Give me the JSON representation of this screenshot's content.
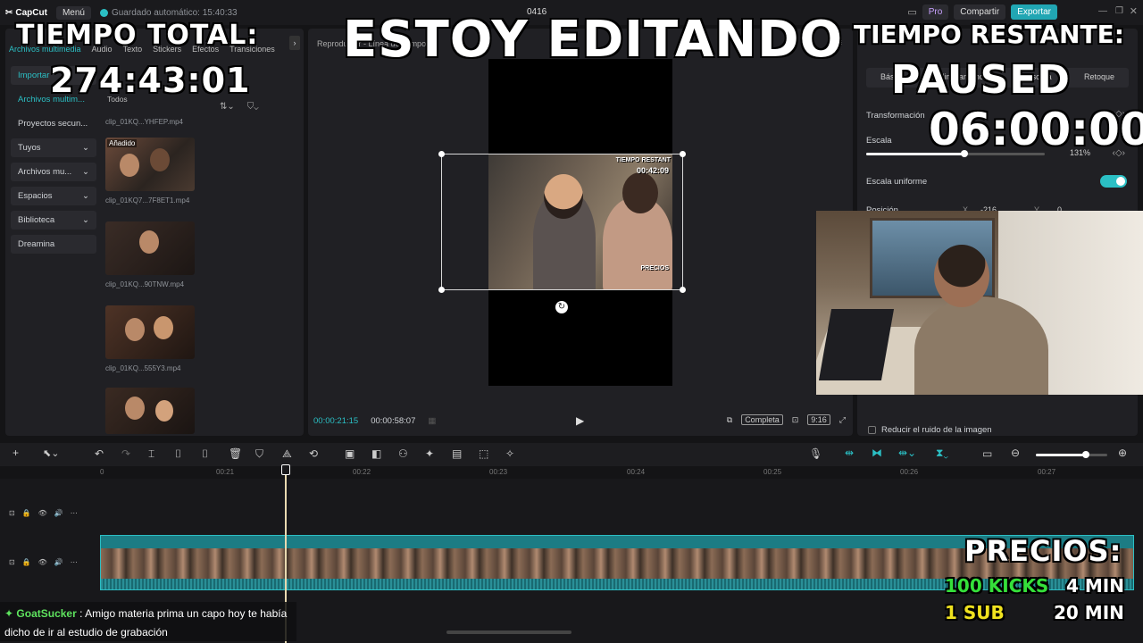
{
  "topbar": {
    "logo": "CapCut",
    "menu": "Menú",
    "autosave": "Guardado automático: 15:40:33",
    "project_name": "0416",
    "pro": "Pro",
    "share": "Compartir",
    "export": "Exportar"
  },
  "left_panel": {
    "tabs": [
      "Archivos multimedia",
      "Audio",
      "Texto",
      "Stickers",
      "Efectos",
      "Transiciones"
    ],
    "nav": [
      {
        "label": "Importar",
        "active": true
      },
      {
        "label": "Archivos multim...",
        "active": false
      },
      {
        "label": "Proyectos secun...",
        "active": false
      },
      {
        "label": "Tuyos",
        "arrow": "⌄"
      },
      {
        "label": "Archivos mu...",
        "arrow": "⌄"
      },
      {
        "label": "Espacios",
        "arrow": "⌄"
      },
      {
        "label": "Biblioteca",
        "arrow": "⌄"
      },
      {
        "label": "Dreamina",
        "arrow": ""
      }
    ],
    "filter_all": "Todos",
    "added_badge": "Añadido",
    "media": [
      {
        "name": "clip_01KQ...YHFEP.mp4"
      },
      {
        "name": "clip_01KQ7...7F8ET1.mp4"
      },
      {
        "name": "clip_01KQ...90TNW.mp4"
      },
      {
        "name": "clip_01KQ...555Y3.mp4"
      }
    ]
  },
  "preview": {
    "title": "Reproductor - Línea de tiempo",
    "current_time": "00:00:21:15",
    "total_time": "00:00:58:07",
    "full_label": "Completa",
    "ratio": "9:16",
    "mini_remaining": "TIEMPO RESTANT",
    "mini_time": "00:42:09",
    "mini_prices": "PRECIOS"
  },
  "right_panel": {
    "tabs": [
      "Básico",
      "Eliminar fondo",
      "Máscara",
      "Retoque"
    ],
    "transform_label": "Transformación",
    "scale_label": "Escala",
    "scale_value": "131%",
    "scale_fraction": 0.55,
    "uniform_label": "Escala uniforme",
    "position_label": "Posición",
    "pos_x_label": "X",
    "pos_x": "-216",
    "pos_y_label": "Y",
    "pos_y": "0",
    "noise_label": "Reducir el ruido de la imagen"
  },
  "timeline": {
    "ticks": [
      "0",
      "00:21",
      "00:22",
      "00:23",
      "00:24",
      "00:25",
      "00:26",
      "00:27"
    ],
    "zoom_fraction": 0.7
  },
  "overlays": {
    "total_label": "TIEMPO TOTAL:",
    "total_value": "274:43:01",
    "center_title": "ESTOY EDITANDO",
    "remaining_label": "TIEMPO RESTANTE:",
    "paused": "PAUSED",
    "remaining_value": "06:00:00",
    "prices_title": "PRECIOS:",
    "price1_left": "100 KICKS",
    "price1_right": "4 MIN",
    "price2_left": "1 SUB",
    "price2_right": "20 MIN"
  },
  "chat": {
    "user": "GoatSucker",
    "message": "Amigo materia prima un capo hoy te había dicho de ir al estudio de grabación"
  },
  "colors": {
    "accent": "#2bbfc4",
    "panel": "#202024",
    "price_green": "#35e03a",
    "price_yellow": "#f0e21f"
  }
}
